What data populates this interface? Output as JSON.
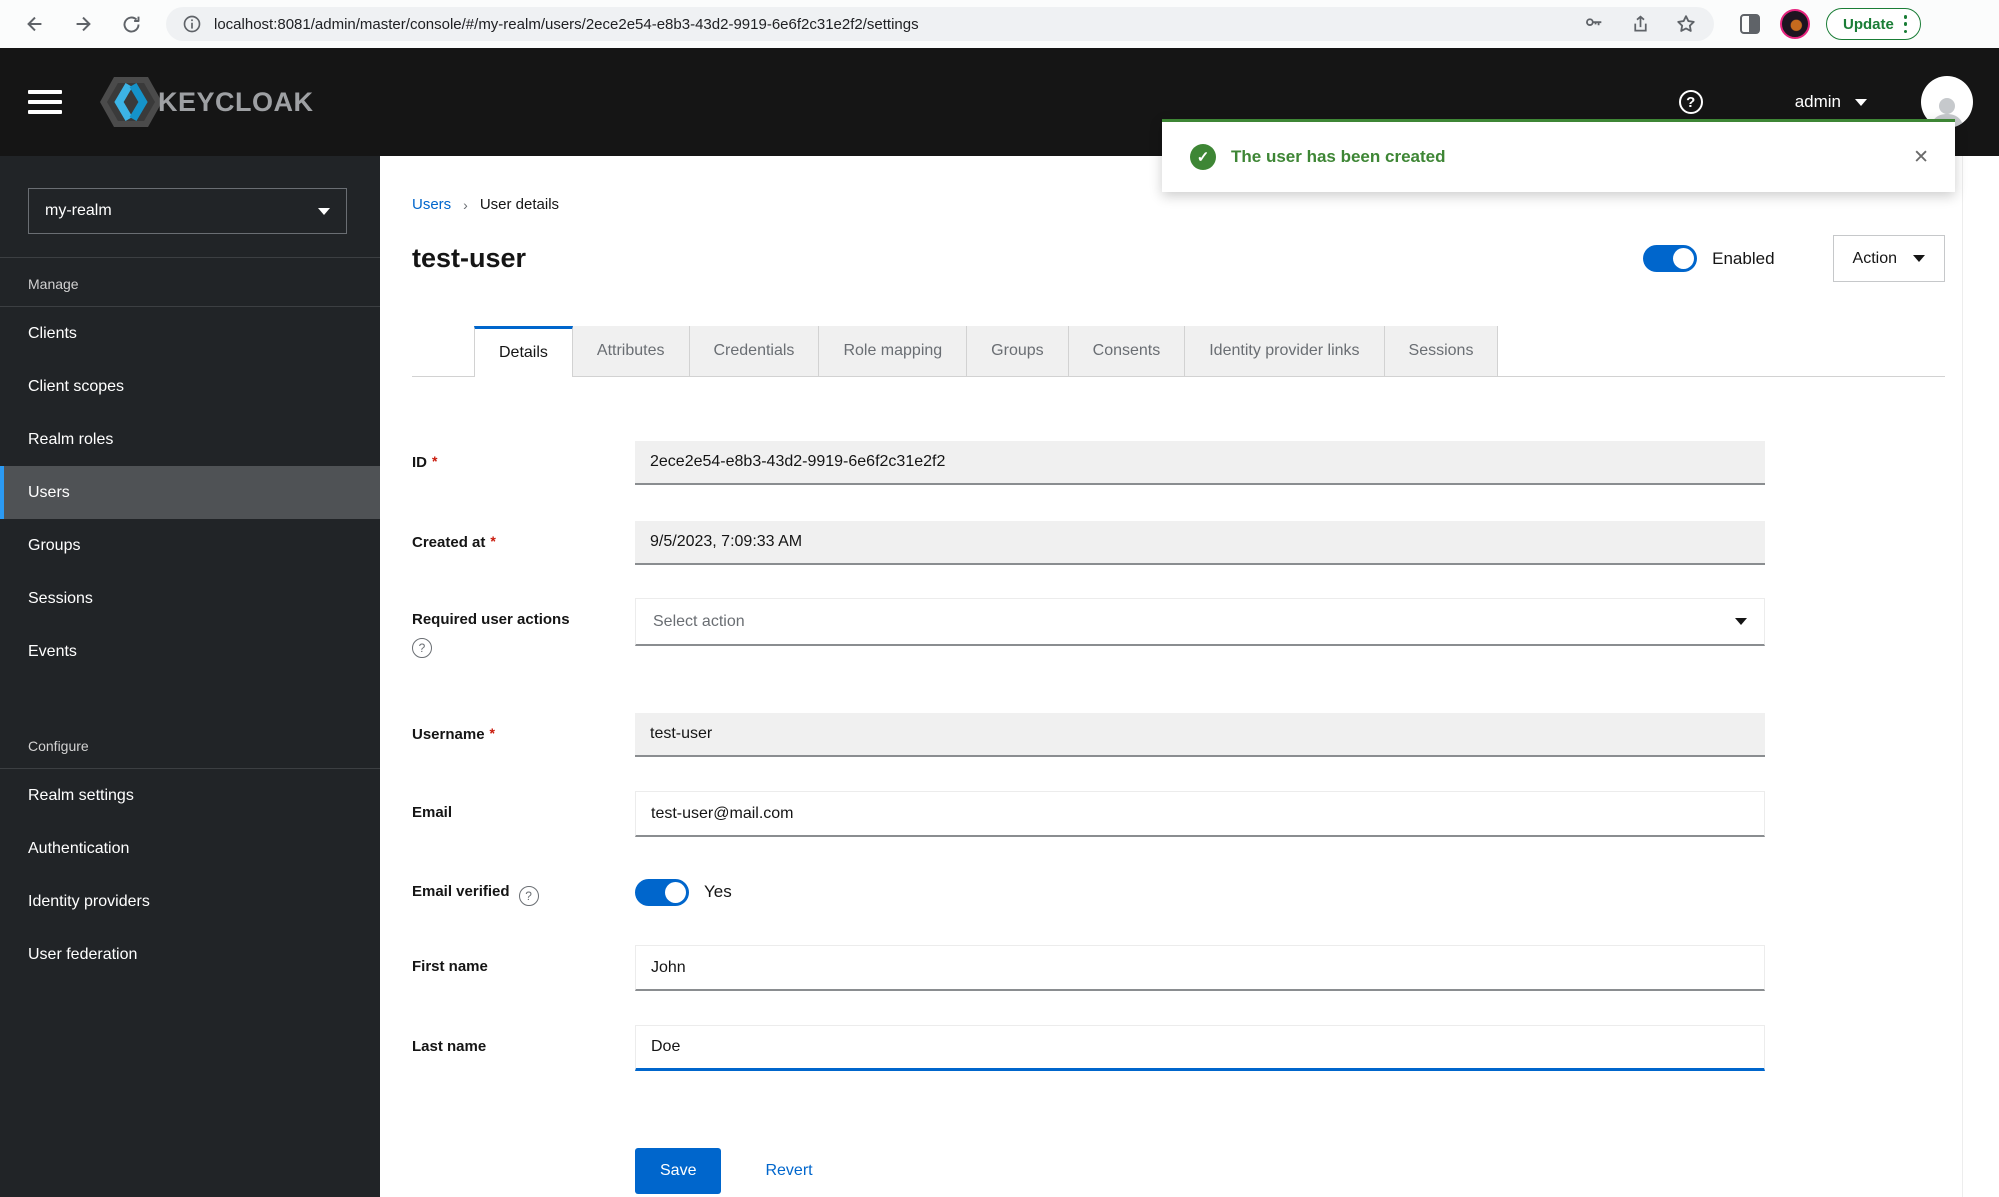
{
  "browser": {
    "url": "localhost:8081/admin/master/console/#/my-realm/users/2ece2e54-e8b3-43d2-9919-6e6f2c31e2f2/settings",
    "update_label": "Update"
  },
  "masthead": {
    "brand": "KEYCLOAK",
    "user": "admin"
  },
  "toast": {
    "message": "The user has been created"
  },
  "sidebar": {
    "realm": "my-realm",
    "sections": [
      {
        "title": "Manage",
        "items": [
          "Clients",
          "Client scopes",
          "Realm roles",
          "Users",
          "Groups",
          "Sessions",
          "Events"
        ]
      },
      {
        "title": "Configure",
        "items": [
          "Realm settings",
          "Authentication",
          "Identity providers",
          "User federation"
        ]
      }
    ],
    "selected_item": "Users"
  },
  "page": {
    "breadcrumb": [
      "Users",
      "User details"
    ],
    "title": "test-user",
    "enabled_label": "Enabled",
    "action_label": "Action",
    "tabs": [
      "Details",
      "Attributes",
      "Credentials",
      "Role mapping",
      "Groups",
      "Consents",
      "Identity provider links",
      "Sessions"
    ],
    "active_tab": "Details"
  },
  "form": {
    "fields": [
      {
        "label": "ID",
        "required": true,
        "readonly": true,
        "value": "2ece2e54-e8b3-43d2-9919-6e6f2c31e2f2"
      },
      {
        "label": "Created at",
        "required": true,
        "readonly": true,
        "value": "9/5/2023, 7:09:33 AM"
      },
      {
        "label": "Required user actions",
        "placeholder": "Select action"
      },
      {
        "label": "Username",
        "required": true,
        "readonly": true,
        "value": "test-user"
      },
      {
        "label": "Email",
        "value": "test-user@mail.com"
      },
      {
        "label": "Email verified",
        "toggle_on": true,
        "state": "Yes"
      },
      {
        "label": "First name",
        "value": "John"
      },
      {
        "label": "Last name",
        "value": "Doe",
        "focused": true
      }
    ],
    "save_label": "Save",
    "revert_label": "Revert"
  },
  "colors": {
    "accent": "#0066cc",
    "success": "#3e8635",
    "masthead_bg": "#151515",
    "sidebar_bg": "#212427",
    "selected_nav_border": "#2b9af3",
    "update_green": "#1a7d36"
  }
}
